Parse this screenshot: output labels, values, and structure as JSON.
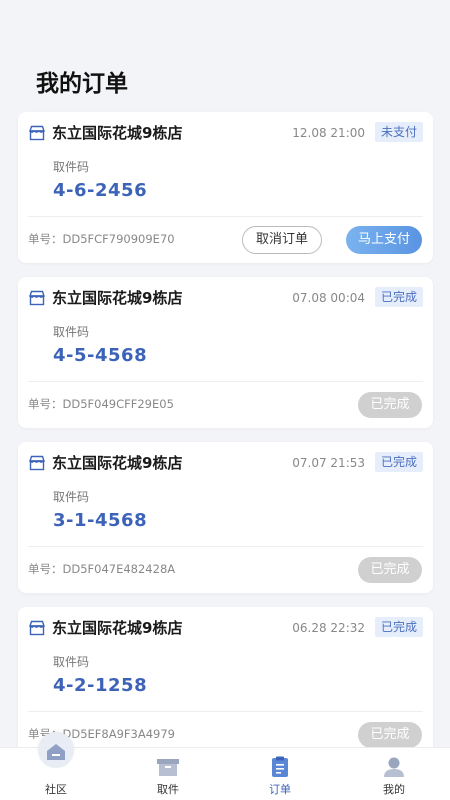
{
  "page": {
    "title": "我的订单"
  },
  "labels": {
    "pickup": "取件码",
    "order_no_prefix": "单号："
  },
  "orders": [
    {
      "store": "东立国际花城9栋店",
      "time": "12.08 21:00",
      "status": "未支付",
      "code": "4-6-2456",
      "order_no": "DD5FCF790909E70",
      "cancel_label": "取消订单",
      "pay_label": "马上支付"
    },
    {
      "store": "东立国际花城9栋店",
      "time": "07.08 00:04",
      "status": "已完成",
      "code": "4-5-4568",
      "order_no": "DD5F049CFF29E05",
      "done_label": "已完成"
    },
    {
      "store": "东立国际花城9栋店",
      "time": "07.07 21:53",
      "status": "已完成",
      "code": "3-1-4568",
      "order_no": "DD5F047E482428A",
      "done_label": "已完成"
    },
    {
      "store": "东立国际花城9栋店",
      "time": "06.28 22:32",
      "status": "已完成",
      "code": "4-2-1258",
      "order_no": "DD5EF8A9F3A4979",
      "done_label": "已完成"
    }
  ],
  "tabbar": {
    "items": [
      {
        "label": "社区",
        "icon": "home-icon"
      },
      {
        "label": "取件",
        "icon": "box-icon"
      },
      {
        "label": "订单",
        "icon": "clipboard-icon",
        "active": true
      },
      {
        "label": "我的",
        "icon": "user-icon"
      }
    ]
  },
  "colors": {
    "accent": "#3d63b8",
    "badge_bg": "#e7eefb",
    "pay_button": "#5a94e2",
    "done_button": "#d0d0d0"
  }
}
